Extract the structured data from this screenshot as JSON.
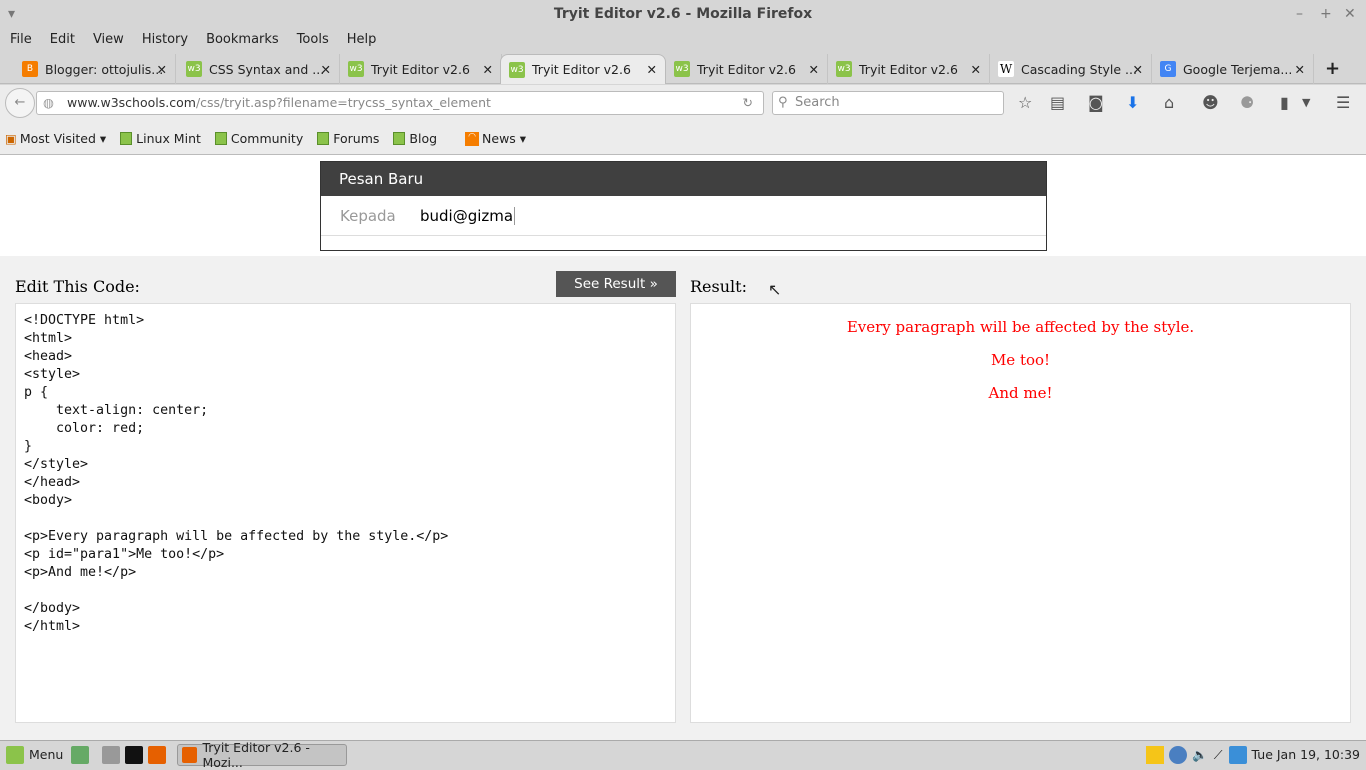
{
  "window": {
    "title": "Tryit Editor v2.6 - Mozilla Firefox"
  },
  "menu": [
    "File",
    "Edit",
    "View",
    "History",
    "Bookmarks",
    "Tools",
    "Help"
  ],
  "tabs": [
    {
      "label": "Blogger: ottojulis...",
      "icon": "blogger-icon",
      "color": "#f57d00"
    },
    {
      "label": "CSS Syntax and ...",
      "icon": "w3-icon",
      "color": "#8bc34a"
    },
    {
      "label": "Tryit Editor v2.6",
      "icon": "w3-icon",
      "color": "#8bc34a"
    },
    {
      "label": "Tryit Editor v2.6",
      "icon": "w3-icon",
      "color": "#8bc34a",
      "active": true
    },
    {
      "label": "Tryit Editor v2.6",
      "icon": "w3-icon",
      "color": "#8bc34a"
    },
    {
      "label": "Tryit Editor v2.6",
      "icon": "w3-icon",
      "color": "#8bc34a"
    },
    {
      "label": "Cascading Style ...",
      "icon": "wikipedia-icon",
      "color": "#ffffff"
    },
    {
      "label": "Google Terjema...",
      "icon": "google-translate-icon",
      "color": "#4285f4"
    }
  ],
  "nav": {
    "url_domain": "www.w3schools.com",
    "url_path": "/css/tryit.asp?filename=trycss_syntax_element",
    "search_placeholder": "Search"
  },
  "bookmarks": [
    "Most Visited",
    "Linux Mint",
    "Community",
    "Forums",
    "Blog",
    "News"
  ],
  "popup": {
    "title": "Pesan Baru",
    "to_label": "Kepada",
    "to_value": "budi@gizma"
  },
  "editor": {
    "label": "Edit This Code:",
    "button": "See Result »",
    "result_label": "Result:",
    "code": "<!DOCTYPE html>\n<html>\n<head>\n<style>\np {\n    text-align: center;\n    color: red;\n}\n</style>\n</head>\n<body>\n\n<p>Every paragraph will be affected by the style.</p>\n<p id=\"para1\">Me too!</p>\n<p>And me!</p>\n\n</body>\n</html>"
  },
  "result": [
    "Every paragraph will be affected by the style.",
    "Me too!",
    "And me!"
  ],
  "taskbar": {
    "menu": "Menu",
    "window": "Tryit Editor v2.6 - Mozi...",
    "clock": "Tue Jan 19, 10:39"
  }
}
